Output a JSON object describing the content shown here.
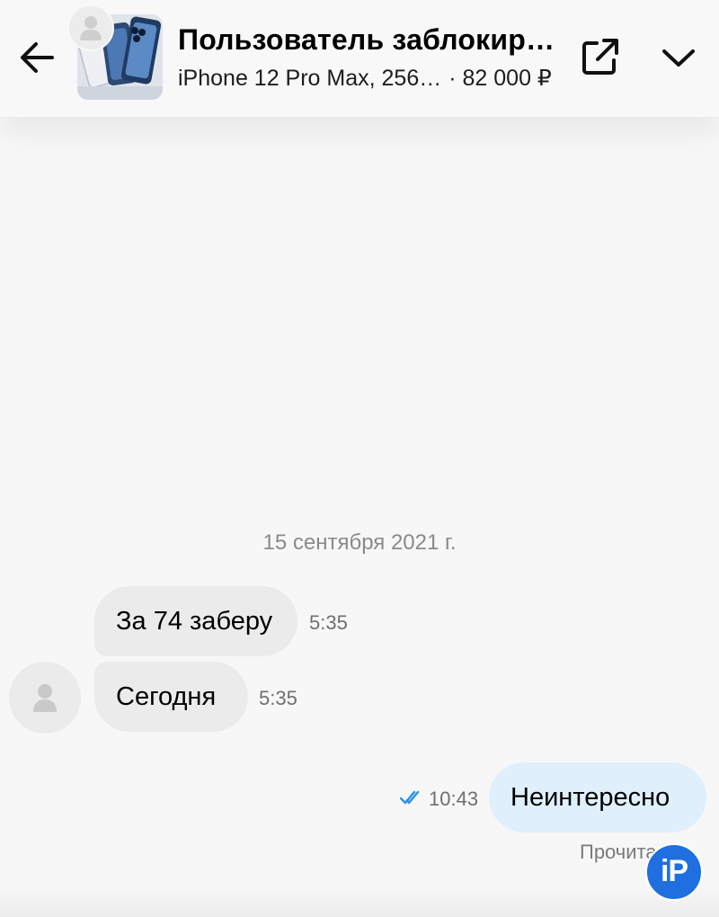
{
  "header": {
    "title": "Пользователь заблокир…",
    "item_name": "iPhone 12 Pro Max, 256…",
    "item_price": "· 82 000 ₽",
    "back_icon": "arrow-left-icon",
    "open_icon": "open-external-icon",
    "expand_icon": "chevron-down-icon"
  },
  "chat": {
    "date_separator": "15 сентября 2021 г.",
    "messages": [
      {
        "direction": "incoming",
        "text": "За 74 заберу",
        "time": "5:35"
      },
      {
        "direction": "incoming",
        "text": "Сегодня",
        "time": "5:35"
      },
      {
        "direction": "outgoing",
        "text": "Неинтересно",
        "time": "10:43",
        "read": true
      }
    ],
    "read_status": "Прочита"
  },
  "watermark": {
    "text": "iP"
  },
  "colors": {
    "background": "#f7f7f7",
    "incoming_bubble": "#ebebeb",
    "outgoing_bubble": "#dfeffb",
    "read_check": "#2a8fe6",
    "watermark": "#1f6fe0"
  }
}
